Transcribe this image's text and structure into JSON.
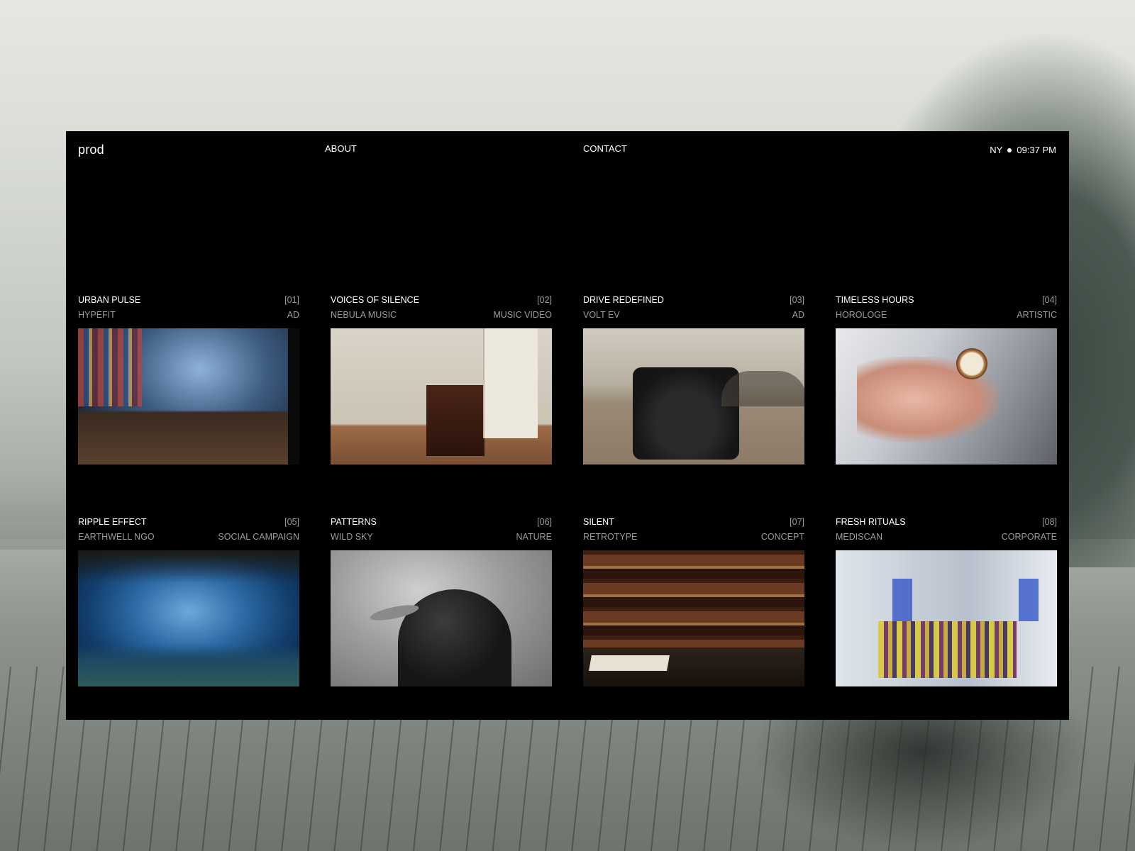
{
  "header": {
    "logo": "prod",
    "nav": {
      "about": "ABOUT",
      "contact": "CONTACT"
    },
    "location": "NY",
    "time": "09:37 PM"
  },
  "projects": [
    {
      "title": "URBAN PULSE",
      "index": "[01]",
      "client": "HYPEFIT",
      "category": "AD"
    },
    {
      "title": "VOICES OF SILENCE",
      "index": "[02]",
      "client": "NEBULA MUSIC",
      "category": "MUSIC VIDEO"
    },
    {
      "title": "DRIVE REDEFINED",
      "index": "[03]",
      "client": "VOLT EV",
      "category": "AD"
    },
    {
      "title": "TIMELESS HOURS",
      "index": "[04]",
      "client": "HOROLOGE",
      "category": "ARTISTIC"
    },
    {
      "title": "RIPPLE EFFECT",
      "index": "[05]",
      "client": "EARTHWELL NGO",
      "category": "SOCIAL CAMPAIGN"
    },
    {
      "title": "PATTERNS",
      "index": "[06]",
      "client": "WILD SKY",
      "category": "NATURE"
    },
    {
      "title": "SILENT",
      "index": "[07]",
      "client": "RETROTYPE",
      "category": "CONCEPT"
    },
    {
      "title": "FRESH RITUALS",
      "index": "[08]",
      "client": "MEDISCAN",
      "category": "CORPORATE"
    }
  ]
}
